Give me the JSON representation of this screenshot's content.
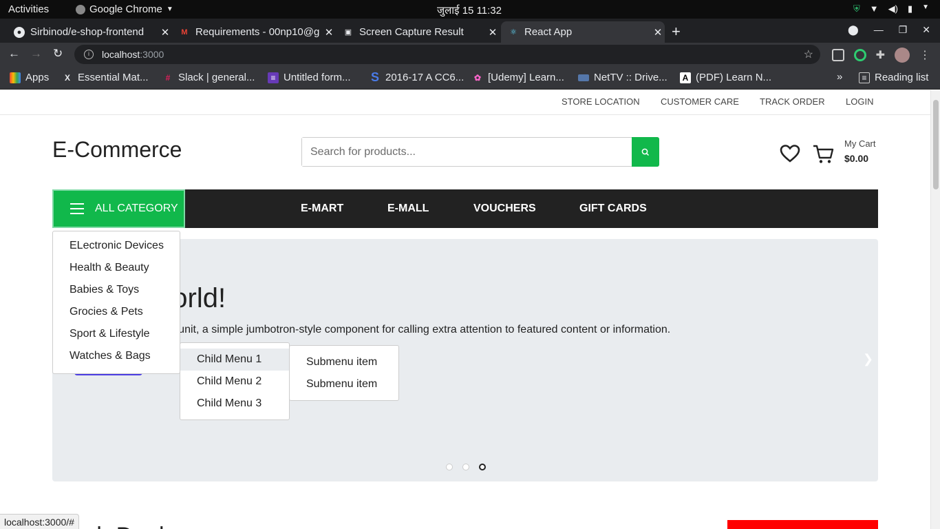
{
  "os": {
    "activities": "Activities",
    "app_name": "Google Chrome",
    "clock": "जुलाई 15  11:32"
  },
  "browser": {
    "tabs": [
      {
        "title": "Sirbinod/e-shop-frontend",
        "icon": "github-icon"
      },
      {
        "title": "Requirements - 00np10@g",
        "icon": "gmail-icon"
      },
      {
        "title": "Screen Capture Result",
        "icon": "camera-icon"
      },
      {
        "title": "React App",
        "icon": "react-icon",
        "active": true
      }
    ],
    "url_host": "localhost",
    "url_port": ":3000",
    "bookmarks": [
      {
        "label": "Apps",
        "icon": "apps-grid-icon"
      },
      {
        "label": "Essential Mat...",
        "icon": "x-icon"
      },
      {
        "label": "Slack | general...",
        "icon": "slack-icon"
      },
      {
        "label": "Untitled form...",
        "icon": "forms-icon"
      },
      {
        "label": "2016-17 A CC6...",
        "icon": "s-icon"
      },
      {
        "label": "[Udemy] Learn...",
        "icon": "udemy-icon"
      },
      {
        "label": "NetTV :: Drive...",
        "icon": "nettv-icon"
      },
      {
        "label": "(PDF) Learn N...",
        "icon": "academia-icon"
      }
    ],
    "reading_list": "Reading list",
    "status_url": "localhost:3000/#"
  },
  "site": {
    "toplinks": [
      "STORE LOCATION",
      "CUSTOMER CARE",
      "TRACK ORDER",
      "LOGIN"
    ],
    "logo": "E-Commerce",
    "search_placeholder": "Search for products...",
    "cart_label": "My Cart",
    "cart_total": "$0.00",
    "all_category": "ALL CATEGORY",
    "nav": [
      "E-MART",
      "E-MALL",
      "VOUCHERS",
      "GIFT CARDS"
    ],
    "jumbo_title": "Hello, world!",
    "jumbo_text": "This is a simple hero unit, a simple jumbotron-style component for calling extra attention to featured content or information.",
    "categories": [
      "ELectronic Devices",
      "Health & Beauty",
      "Babies & Toys",
      "Grocies & Pets",
      "Sport & Lifestyle",
      "Watches & Bags"
    ],
    "child_menu": [
      "Child Menu 1",
      "Child Menu 2",
      "Child Menu 3"
    ],
    "submenu": [
      "Submenu item",
      "Submenu item"
    ],
    "section_title": "Flash Deals",
    "carousel": {
      "slides": 3,
      "active": 3
    }
  },
  "colors": {
    "accent": "#11b84b",
    "navbar": "#222222",
    "jumbotron": "#e9ecef",
    "learn_more": "#4b3de2",
    "red_banner": "#ff0000"
  }
}
